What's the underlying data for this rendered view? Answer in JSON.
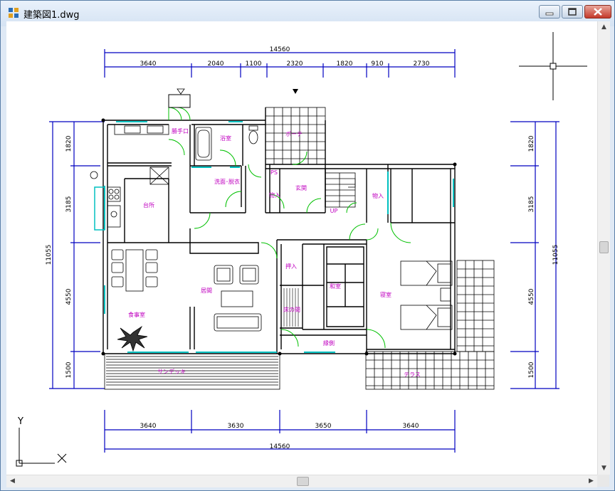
{
  "window": {
    "title": "建築図1.dwg",
    "accent": "#c4392a"
  },
  "icons": {
    "app": "drawing-app-icon",
    "minimize": "minimize-icon",
    "maximize": "maximize-icon",
    "close": "close-icon",
    "compass": "ucs-compass-icon"
  },
  "colors": {
    "dimension": "#0000c0",
    "room_label": "#c000c0",
    "door_arc": "#00c000",
    "window": "#00c0c0",
    "wall": "#000000"
  },
  "dimensions": {
    "top_total": "14560",
    "top_segments": [
      "3640",
      "2040",
      "1100",
      "2320",
      "1820",
      "910",
      "2730"
    ],
    "bottom_total": "14560",
    "bottom_segments": [
      "3640",
      "3630",
      "3650",
      "3640"
    ],
    "left_total": "11055",
    "left_segments": [
      "1820",
      "3185",
      "4550",
      "1500"
    ],
    "right_total": "11055",
    "right_segments": [
      "1820",
      "3185",
      "4550",
      "1500"
    ]
  },
  "rooms": {
    "katteguchi": "勝手口",
    "yokushitsu": "浴室",
    "porch": "ポーチ",
    "senmen": "洗面･脱衣",
    "ps": "PS",
    "monoire1": "物入",
    "genkan": "玄関",
    "monoire2": "物入",
    "up": "UP",
    "daidokoro": "台所",
    "oshiire": "押入",
    "ima": "居間",
    "washitsu": "和室",
    "shinshitsu": "寝室",
    "shokujishitsu": "食事室",
    "tokonoma": "床の間",
    "engawa": "縁側",
    "sundeck": "サンデッキ",
    "terrace": "テラス"
  },
  "axes": {
    "y_label": "Y",
    "x_label": "X"
  }
}
